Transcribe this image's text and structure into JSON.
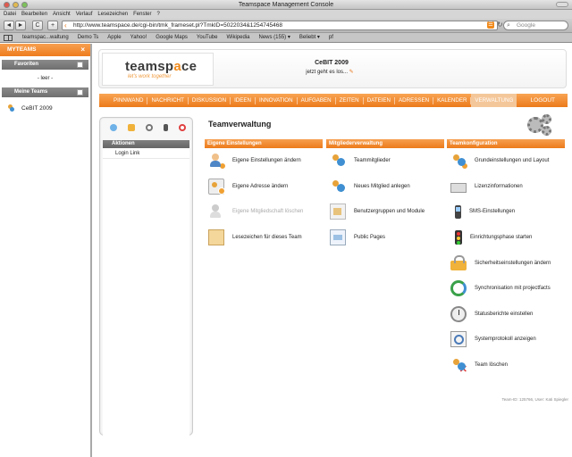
{
  "window": {
    "title": "Teamspace Management Console"
  },
  "menubar": [
    "Datei",
    "Bearbeiten",
    "Ansicht",
    "Verlauf",
    "Lesezeichen",
    "Fenster",
    "?"
  ],
  "toolbar": {
    "url": "http://www.teamspace.de/cgi-bin/tmk_frameset.pl?TmkID=5022034&1254745468",
    "search_placeholder": "Google",
    "back_icon": "◄",
    "forward_icon": "►",
    "reload_icon": "C",
    "add_icon": "+"
  },
  "bookmarks": [
    "teamspac...waltung",
    "Demo Ts",
    "Apple",
    "Yahoo!",
    "Google Maps",
    "YouTube",
    "Wikipedia",
    "News (155) ▾",
    "Beliebt ▾",
    "pf"
  ],
  "sidebar": {
    "header": "MYTEAMS",
    "close": "×",
    "favorites_label": "Favoriten",
    "favorites_empty": "- leer -",
    "teams_label": "Meine Teams",
    "teams": [
      "CeBIT 2009"
    ]
  },
  "header": {
    "logo_text_a": "teamsp",
    "logo_text_b": "a",
    "logo_text_c": "ce",
    "tagline": "let's work together",
    "team_title": "CeBIT 2009",
    "team_status": "jetzt geht es los..."
  },
  "nav": {
    "items": [
      "PINNWAND",
      "NACHRICHT",
      "DISKUSSION",
      "IDEEN",
      "INNOVATION",
      "AUFGABEN",
      "ZEITEN",
      "DATEIEN",
      "ADRESSEN",
      "KALENDER",
      "VERWALTUNG"
    ],
    "logout": "LOGOUT"
  },
  "left_panel": {
    "section": "Aktionen",
    "link": "Login Link"
  },
  "page": {
    "title": "Teamverwaltung"
  },
  "columns": [
    {
      "header": "Eigene Einstellungen",
      "items": [
        "Eigene Einstellungen ändern",
        "Eigene Adresse ändern",
        "Eigene Mitgliedschaft löschen",
        "Lesezeichen für dieses Team"
      ]
    },
    {
      "header": "Mitgliederverwaltung",
      "items": [
        "Teammitglieder",
        "Neues Mitglied anlegen",
        "Benutzergruppen und Module",
        "Public Pages"
      ]
    },
    {
      "header": "Teamkonfiguration",
      "items": [
        "Grundeinstellungen und Layout",
        "Lizenzinformationen",
        "SMS-Einstellungen",
        "Einrichtungsphase starten",
        "Sicherheitseinstellungen ändern",
        "Synchronisation mit projectfacts",
        "Statusberichte einstellen",
        "Systemprotokoll anzeigen",
        "Team löschen"
      ]
    }
  ],
  "footer": {
    "note": "Team-ID: 125766, User: Kati Spiegler"
  },
  "colors": {
    "accent": "#EE7C1E",
    "section_gray": "#777777"
  }
}
